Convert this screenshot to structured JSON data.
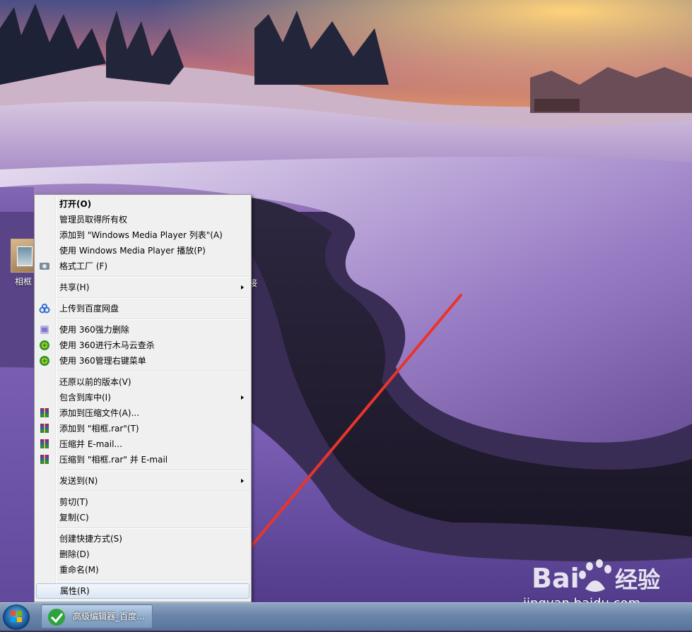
{
  "desktop": {
    "icons": [
      {
        "label": "相框"
      },
      {
        "label": "接"
      }
    ]
  },
  "context_menu": {
    "items": [
      {
        "type": "item",
        "label": "打开(O)",
        "bold": true
      },
      {
        "type": "item",
        "label": "管理员取得所有权"
      },
      {
        "type": "item",
        "label": "添加到 \"Windows Media Player 列表\"(A)"
      },
      {
        "type": "item",
        "label": "使用 Windows Media Player 播放(P)"
      },
      {
        "type": "item",
        "label": "格式工厂 (F)",
        "icon": "format-factory-icon"
      },
      {
        "type": "separator"
      },
      {
        "type": "item",
        "label": "共享(H)",
        "submenu": true
      },
      {
        "type": "separator"
      },
      {
        "type": "item",
        "label": "上传到百度网盘",
        "icon": "baidu-netdisk-icon"
      },
      {
        "type": "separator"
      },
      {
        "type": "item",
        "label": "使用 360强力删除",
        "icon": "360-shred-icon"
      },
      {
        "type": "item",
        "label": "使用 360进行木马云查杀",
        "icon": "360-scan-icon"
      },
      {
        "type": "item",
        "label": "使用 360管理右键菜单",
        "icon": "360-menu-icon"
      },
      {
        "type": "separator"
      },
      {
        "type": "item",
        "label": "还原以前的版本(V)"
      },
      {
        "type": "item",
        "label": "包含到库中(I)",
        "submenu": true
      },
      {
        "type": "item",
        "label": "添加到压缩文件(A)...",
        "icon": "winrar-icon"
      },
      {
        "type": "item",
        "label": "添加到 \"相框.rar\"(T)",
        "icon": "winrar-icon"
      },
      {
        "type": "item",
        "label": "压缩并 E-mail...",
        "icon": "winrar-icon"
      },
      {
        "type": "item",
        "label": "压缩到 \"相框.rar\" 并 E-mail",
        "icon": "winrar-icon"
      },
      {
        "type": "separator"
      },
      {
        "type": "item",
        "label": "发送到(N)",
        "submenu": true
      },
      {
        "type": "separator"
      },
      {
        "type": "item",
        "label": "剪切(T)"
      },
      {
        "type": "item",
        "label": "复制(C)"
      },
      {
        "type": "separator"
      },
      {
        "type": "item",
        "label": "创建快捷方式(S)"
      },
      {
        "type": "item",
        "label": "删除(D)"
      },
      {
        "type": "item",
        "label": "重命名(M)"
      },
      {
        "type": "separator"
      },
      {
        "type": "item",
        "label": "属性(R)",
        "highlighted": true
      }
    ]
  },
  "taskbar": {
    "start_icon": "windows-logo-icon",
    "active_item": {
      "label": "高级编辑器_百度...",
      "icon": "browser-icon"
    }
  },
  "watermark": {
    "brand": "Bai 经验",
    "url": "jingyan.baidu.com"
  },
  "annotation": {
    "color": "#e8352b"
  }
}
